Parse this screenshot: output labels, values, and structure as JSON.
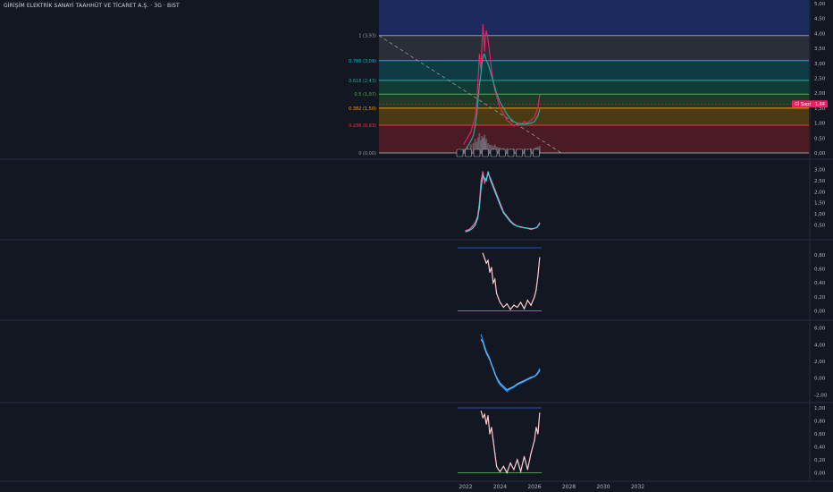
{
  "header": {
    "title": "GİRİŞİM ELEKTRİK SANAYİ TAAHHÜT VE TİCARET A.Ş. · 3G · BIST"
  },
  "price_badge": {
    "label": "Gİ Şapt",
    "value": "1,64",
    "color": "#e91e63"
  },
  "chart_data": [
    {
      "type": "line",
      "pane": "main",
      "ylim": [
        0,
        5
      ],
      "y_ticks": [
        "0,00",
        "0,50",
        "1,00",
        "1,50",
        "2,00",
        "2,50",
        "3,00",
        "3,50",
        "4,00",
        "4,50",
        "5,00"
      ],
      "fib_levels": [
        {
          "label": "1 (3,93)",
          "value": 3.93,
          "color": "#9598a1",
          "fill": "#2a2e39"
        },
        {
          "label": "0.786 (3,09)",
          "value": 3.09,
          "color": "#00bcd4",
          "fill": "#0f3b44"
        },
        {
          "label": "0.618 (2,43)",
          "value": 2.43,
          "color": "#26a69a",
          "fill": "#123b36"
        },
        {
          "label": "0.5 (1,97)",
          "value": 1.97,
          "color": "#4caf50",
          "fill": "#1e3a26"
        },
        {
          "label": "0.382 (1,50)",
          "value": 1.5,
          "color": "#ff9800",
          "fill": "#4b3a13"
        },
        {
          "label": "0.236 (0,93)",
          "value": 0.93,
          "color": "#f23645",
          "fill": "#4a1b24"
        },
        {
          "label": "0 (0,00)",
          "value": 0.0,
          "color": "#9598a1",
          "fill": null
        }
      ],
      "x": [
        2021.9,
        2022.1,
        2022.3,
        2022.45,
        2022.55,
        2022.65,
        2022.72,
        2022.8,
        2022.88,
        2022.95,
        2023.0,
        2023.05,
        2023.1,
        2023.15,
        2023.2,
        2023.3,
        2023.4,
        2023.5,
        2023.6,
        2023.7,
        2023.8,
        2023.9,
        2024.0,
        2024.2,
        2024.4,
        2024.6,
        2024.8,
        2025.0,
        2025.2,
        2025.4,
        2025.6,
        2025.8,
        2026.0,
        2026.1,
        2026.2,
        2026.3
      ],
      "series": [
        {
          "values": [
            0.3,
            0.5,
            0.7,
            1.0,
            1.2,
            1.7,
            2.5,
            3.3,
            2.8,
            3.6,
            4.3,
            3.9,
            3.4,
            3.9,
            4.1,
            3.8,
            3.3,
            2.8,
            2.4,
            2.1,
            1.9,
            1.7,
            1.5,
            1.3,
            1.1,
            1.0,
            0.9,
            1.0,
            0.95,
            1.05,
            1.0,
            1.1,
            1.2,
            1.35,
            1.5,
            1.95
          ],
          "color": "#e91e63"
        },
        {
          "values": [
            0.05,
            0.2,
            0.4,
            0.6,
            0.9,
            1.3,
            1.8,
            2.3,
            2.6,
            3.0,
            3.2,
            3.3,
            3.3,
            3.2,
            3.1,
            3.0,
            2.8,
            2.6,
            2.4,
            2.2,
            2.0,
            1.85,
            1.7,
            1.5,
            1.3,
            1.15,
            1.05,
            1.0,
            0.98,
            0.97,
            0.98,
            1.0,
            1.05,
            1.15,
            1.25,
            1.45
          ],
          "color": "#26a69a"
        }
      ],
      "volume": [
        0.15,
        0.25,
        0.3,
        0.35,
        0.5,
        0.4,
        0.55,
        0.7,
        0.45,
        0.6,
        0.5,
        0.55,
        0.65,
        0.4,
        0.5,
        0.35,
        0.3,
        0.28,
        0.25,
        0.3,
        0.22,
        0.2,
        0.2,
        0.18,
        0.17,
        0.15,
        0.16,
        0.15,
        0.14,
        0.16,
        0.15,
        0.17,
        0.18,
        0.2,
        0.22,
        0.25
      ]
    },
    {
      "type": "line",
      "pane": "oscillator-1",
      "ylim": [
        0,
        3.3
      ],
      "y_ticks": [
        "0,50",
        "1,00",
        "1,50",
        "2,00",
        "2,50",
        "3,00"
      ],
      "x": [
        2022.0,
        2022.2,
        2022.4,
        2022.55,
        2022.7,
        2022.8,
        2022.9,
        2023.0,
        2023.1,
        2023.2,
        2023.3,
        2023.45,
        2023.6,
        2023.75,
        2023.9,
        2024.05,
        2024.2,
        2024.4,
        2024.6,
        2024.8,
        2025.0,
        2025.2,
        2025.4,
        2025.6,
        2025.8,
        2026.0,
        2026.15,
        2026.3
      ],
      "series": [
        {
          "values": [
            0.25,
            0.3,
            0.45,
            0.6,
            0.9,
            1.5,
            2.5,
            2.9,
            2.4,
            2.6,
            2.8,
            2.6,
            2.3,
            2.0,
            1.7,
            1.4,
            1.1,
            0.9,
            0.7,
            0.55,
            0.45,
            0.4,
            0.38,
            0.35,
            0.3,
            0.35,
            0.4,
            0.6
          ],
          "color": "#f06292"
        },
        {
          "values": [
            0.2,
            0.25,
            0.35,
            0.5,
            0.8,
            1.3,
            2.2,
            2.7,
            2.6,
            2.5,
            2.9,
            2.5,
            2.2,
            1.9,
            1.6,
            1.3,
            1.05,
            0.85,
            0.65,
            0.52,
            0.45,
            0.42,
            0.38,
            0.36,
            0.34,
            0.35,
            0.4,
            0.55
          ],
          "color": "#4dd0e1"
        }
      ]
    },
    {
      "type": "line",
      "pane": "oscillator-2",
      "ylim": [
        -0.02,
        0.9
      ],
      "y_ticks": [
        "0,00",
        "0,20",
        "0,40",
        "0,60",
        "0,80"
      ],
      "reference_lines": [
        0.9,
        0.0
      ],
      "x": [
        2023.0,
        2023.1,
        2023.2,
        2023.3,
        2023.4,
        2023.5,
        2023.6,
        2023.7,
        2023.8,
        2023.9,
        2024.0,
        2024.2,
        2024.4,
        2024.6,
        2024.8,
        2025.0,
        2025.2,
        2025.4,
        2025.6,
        2025.8,
        2026.0,
        2026.1,
        2026.2,
        2026.3
      ],
      "series": [
        {
          "values": [
            0.82,
            0.75,
            0.68,
            0.72,
            0.55,
            0.62,
            0.4,
            0.45,
            0.25,
            0.18,
            0.12,
            0.05,
            0.1,
            0.02,
            0.08,
            0.05,
            0.12,
            0.03,
            0.15,
            0.08,
            0.2,
            0.3,
            0.5,
            0.76
          ],
          "color": "#ffcdd2"
        }
      ]
    },
    {
      "type": "line",
      "pane": "oscillator-3",
      "ylim": [
        -2.5,
        6.5
      ],
      "y_ticks": [
        "-2,00",
        "0,00",
        "2,00",
        "4,00",
        "6,00"
      ],
      "x": [
        2022.9,
        2023.0,
        2023.1,
        2023.2,
        2023.3,
        2023.4,
        2023.5,
        2023.6,
        2023.7,
        2023.8,
        2023.9,
        2024.0,
        2024.2,
        2024.4,
        2024.6,
        2024.8,
        2025.0,
        2025.2,
        2025.4,
        2025.6,
        2025.8,
        2026.0,
        2026.1,
        2026.2,
        2026.3
      ],
      "series": [
        {
          "values": [
            5.2,
            4.5,
            3.8,
            3.2,
            2.8,
            2.3,
            1.7,
            1.2,
            0.6,
            0.0,
            -0.5,
            -0.8,
            -1.2,
            -1.6,
            -1.3,
            -1.1,
            -0.8,
            -0.6,
            -0.4,
            -0.2,
            0.0,
            0.2,
            0.4,
            0.7,
            1.1
          ],
          "color": "#2196f3"
        },
        {
          "values": [
            4.6,
            4.3,
            3.6,
            3.0,
            2.6,
            2.2,
            1.6,
            1.1,
            0.5,
            0.1,
            -0.3,
            -0.6,
            -1.0,
            -1.4,
            -1.2,
            -1.0,
            -0.7,
            -0.5,
            -0.3,
            -0.1,
            0.1,
            0.2,
            0.35,
            0.6,
            0.9
          ],
          "color": "#64b5f6"
        }
      ]
    },
    {
      "type": "line",
      "pane": "oscillator-4",
      "ylim": [
        -0.02,
        1.0
      ],
      "y_ticks": [
        "0,00",
        "0,20",
        "0,40",
        "0,60",
        "0,80",
        "1,00"
      ],
      "reference_lines": [
        1.0,
        0.0
      ],
      "x": [
        2022.9,
        2023.0,
        2023.1,
        2023.2,
        2023.3,
        2023.4,
        2023.5,
        2023.6,
        2023.7,
        2023.8,
        2023.9,
        2024.0,
        2024.2,
        2024.4,
        2024.6,
        2024.8,
        2025.0,
        2025.2,
        2025.4,
        2025.6,
        2025.8,
        2026.0,
        2026.1,
        2026.2,
        2026.3
      ],
      "series": [
        {
          "values": [
            0.95,
            0.85,
            0.9,
            0.75,
            0.88,
            0.6,
            0.7,
            0.5,
            0.3,
            0.1,
            0.05,
            0.02,
            0.1,
            0.0,
            0.15,
            0.05,
            0.2,
            0.02,
            0.25,
            0.05,
            0.3,
            0.5,
            0.7,
            0.6,
            0.92
          ],
          "color": "#ffcdd2"
        }
      ]
    }
  ],
  "x_axis": {
    "ticks": [
      "2022",
      "2024",
      "2026",
      "2028",
      "2030",
      "2032"
    ]
  }
}
